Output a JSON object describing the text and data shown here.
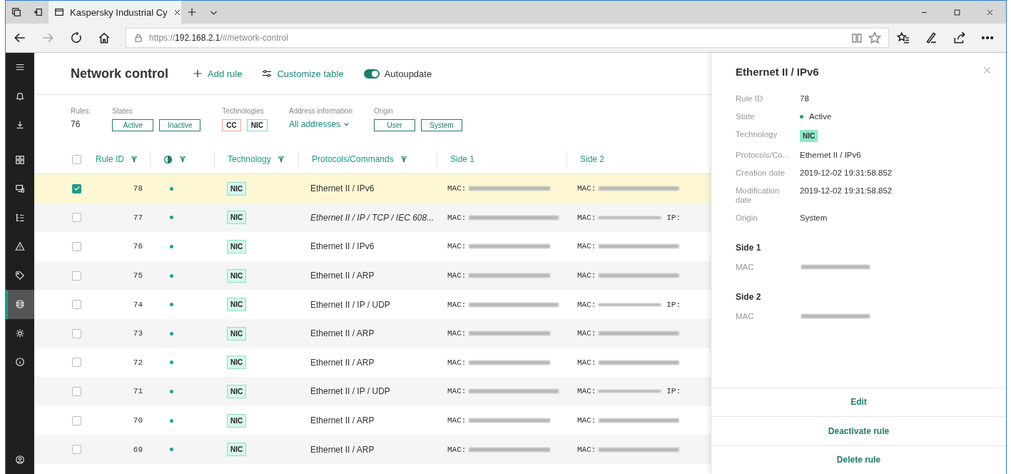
{
  "browser": {
    "tabs": [
      {
        "title": "Kaspersky Industrial Cy",
        "selected": true
      }
    ],
    "url_prefix": "https://",
    "url_host": "192.168.2.1",
    "url_path": "/#/network-control"
  },
  "sidebar": {
    "items": [
      {
        "selected": false
      },
      {
        "selected": false
      },
      {
        "selected": false
      },
      {
        "selected": false
      },
      {
        "selected": false
      },
      {
        "selected": false
      },
      {
        "selected": false
      },
      {
        "selected": false
      },
      {
        "selected": true
      },
      {
        "selected": false
      },
      {
        "selected": false
      }
    ]
  },
  "page": {
    "title": "Network control",
    "add_rule": "Add rule",
    "customize": "Customize table",
    "autoupdate": {
      "label": "Autoupdate",
      "on": true
    }
  },
  "filters": {
    "rules_label": "Rules:",
    "rules_count": "76",
    "states": {
      "label": "States",
      "chips": [
        "Active",
        "Inactive"
      ]
    },
    "technologies": {
      "label": "Technologies",
      "chips": [
        {
          "text": "CC",
          "color": "#f4a58a"
        },
        {
          "text": "NIC",
          "color": "#7fdcc0"
        }
      ]
    },
    "address": {
      "label": "Address information",
      "value": "All addresses"
    },
    "origin": {
      "label": "Origin",
      "chips": [
        "User",
        "System"
      ]
    }
  },
  "table": {
    "select_all": {
      "checked": false
    },
    "columns": [
      {
        "label": "Rule ID",
        "filter": true
      },
      {
        "kind": "state",
        "filter": true
      },
      {
        "label": "Technology",
        "filter": true
      },
      {
        "label": "Protocols/Commands",
        "filter": true
      },
      {
        "label": "Side 1",
        "filter": false
      },
      {
        "label": "Side 2",
        "filter": false
      }
    ],
    "rows": [
      {
        "id": "78",
        "active": true,
        "technology": "NIC",
        "protocol": "Ethernet II / IPv6",
        "italic": false,
        "side1": "MAC:",
        "side2": "MAC:",
        "checked": true,
        "selected": true
      },
      {
        "id": "77",
        "active": true,
        "technology": "NIC",
        "protocol": "Ethernet II / IP / TCP / IEC 608...",
        "italic": true,
        "side1": "MAC:",
        "side2": "MAC:",
        "side2_extra": "IP:",
        "checked": false,
        "selected": false
      },
      {
        "id": "76",
        "active": true,
        "technology": "NIC",
        "protocol": "Ethernet II / IPv6",
        "italic": false,
        "side1": "MAC:",
        "side2": "MAC:",
        "checked": false,
        "selected": false
      },
      {
        "id": "75",
        "active": true,
        "technology": "NIC",
        "protocol": "Ethernet II / ARP",
        "italic": false,
        "side1": "MAC:",
        "side2": "MAC:",
        "checked": false,
        "selected": false
      },
      {
        "id": "74",
        "active": true,
        "technology": "NIC",
        "protocol": "Ethernet II / IP / UDP",
        "italic": false,
        "side1": "MAC:",
        "side2": "MAC:",
        "side2_extra": "IP:",
        "checked": false,
        "selected": false
      },
      {
        "id": "73",
        "active": true,
        "technology": "NIC",
        "protocol": "Ethernet II / ARP",
        "italic": false,
        "side1": "MAC:",
        "side2": "MAC:",
        "checked": false,
        "selected": false
      },
      {
        "id": "72",
        "active": true,
        "technology": "NIC",
        "protocol": "Ethernet II / ARP",
        "italic": false,
        "side1": "MAC:",
        "side2": "MAC:",
        "checked": false,
        "selected": false
      },
      {
        "id": "71",
        "active": true,
        "technology": "NIC",
        "protocol": "Ethernet II / IP / UDP",
        "italic": false,
        "side1": "MAC:",
        "side2": "MAC:",
        "side2_extra": "IP:",
        "checked": false,
        "selected": false
      },
      {
        "id": "70",
        "active": true,
        "technology": "NIC",
        "protocol": "Ethernet II / ARP",
        "italic": false,
        "side1": "MAC:",
        "side2": "MAC:",
        "checked": false,
        "selected": false
      },
      {
        "id": "69",
        "active": true,
        "technology": "NIC",
        "protocol": "Ethernet II / ARP",
        "italic": false,
        "side1": "MAC:",
        "side2": "MAC:",
        "checked": false,
        "selected": false
      }
    ]
  },
  "panel": {
    "title": "Ethernet II / IPv6",
    "fields": [
      {
        "label": "Rule ID",
        "value": "78",
        "kind": "text"
      },
      {
        "label": "State",
        "value": "Active",
        "kind": "status"
      },
      {
        "label": "Technology",
        "value": "NIC",
        "kind": "badge"
      },
      {
        "label": "Protocols/Co...",
        "value": "Ethernet II / IPv6",
        "kind": "text"
      },
      {
        "label": "Creation date",
        "value": "2019-12-02 19:31:58.852",
        "kind": "text"
      },
      {
        "label": "Modification date",
        "value": "2019-12-02 19:31:58.852",
        "kind": "text"
      },
      {
        "label": "Origin",
        "value": "System",
        "kind": "text"
      }
    ],
    "sections": [
      {
        "title": "Side 1",
        "fields": [
          {
            "label": "MAC"
          }
        ]
      },
      {
        "title": "Side 2",
        "fields": [
          {
            "label": "MAC"
          }
        ]
      }
    ],
    "actions": [
      "Edit",
      "Deactivate rule",
      "Delete rule"
    ]
  }
}
